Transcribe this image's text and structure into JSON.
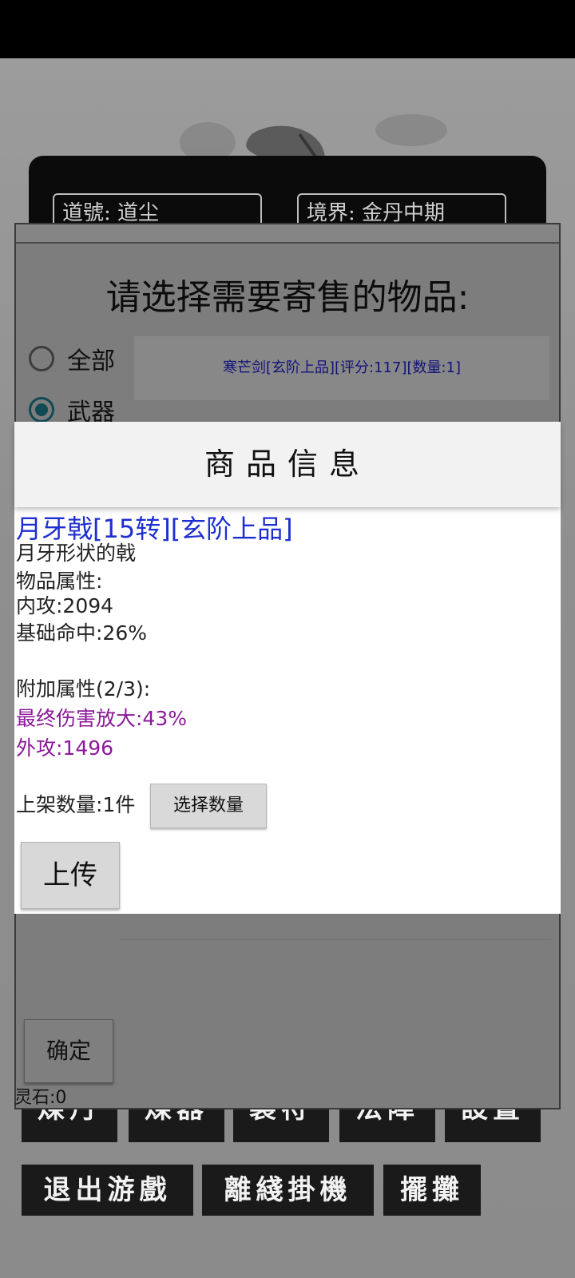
{
  "background": {
    "info_fields": [
      {
        "label": "道號:",
        "value": "道尘"
      },
      {
        "label": "境界:",
        "value": "金丹中期"
      }
    ],
    "menu_row1": [
      "煉丹",
      "煉器",
      "製符",
      "法陣",
      "設置"
    ],
    "menu_row2": [
      "退出游戲",
      "離綫掛機",
      "擺攤"
    ]
  },
  "sell_dialog": {
    "title": "请选择需要寄售的物品:",
    "filters": [
      {
        "label": "全部",
        "checked": false
      },
      {
        "label": "武器",
        "checked": true
      }
    ],
    "list_items": [
      "寒芒剑[玄阶上品][评分:117][数量:1]"
    ],
    "confirm_label": "确定",
    "lingshi_text": "灵石:0"
  },
  "product_info": {
    "header": "商品信息",
    "name": "月牙戟[15转][玄阶上品]",
    "description": "月牙形状的戟",
    "attr_title": "物品属性:",
    "attrs": [
      "内攻:2094",
      "基础命中:26%"
    ],
    "extra_title": "附加属性(2/3):",
    "extra_attrs": [
      "最终伤害放大:43%",
      "外攻:1496"
    ],
    "quantity_text": "上架数量:1件",
    "select_quantity_label": "选择数量",
    "upload_label": "上传"
  },
  "colors": {
    "item_name": "#1e2fd0",
    "extra_attr": "#8b1a9a",
    "list_item_text": "#12127a"
  }
}
